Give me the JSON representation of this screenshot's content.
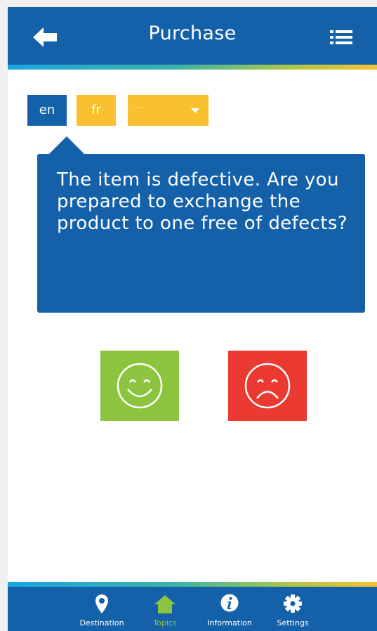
{
  "header": {
    "title": "Purchase",
    "back_icon": "arrow-left-icon",
    "menu_icon": "list-icon",
    "color": "#1461a9"
  },
  "languages": {
    "items": [
      {
        "label": "en",
        "selected": true
      },
      {
        "label": "fr",
        "selected": false
      }
    ],
    "more": {
      "label": "...",
      "icon": "caret-down-icon"
    },
    "colors": {
      "selected": "#1461a9",
      "unselected": "#f9c02f"
    }
  },
  "question": {
    "text": "The item is defective. Are you prepared to exchange the product to one free of defects?"
  },
  "answers": {
    "yes": {
      "icon": "smile-icon",
      "color": "#8dc43f"
    },
    "no": {
      "icon": "sad-face-icon",
      "color": "#ea3a32"
    }
  },
  "nav": {
    "items": [
      {
        "label": "Destination",
        "icon": "map-pin-icon",
        "active": false
      },
      {
        "label": "Topics",
        "icon": "home-icon",
        "active": true
      },
      {
        "label": "Information",
        "icon": "info-icon",
        "active": false
      },
      {
        "label": "Settings",
        "icon": "gear-icon",
        "active": false
      }
    ],
    "active_color": "#8dc43f"
  }
}
